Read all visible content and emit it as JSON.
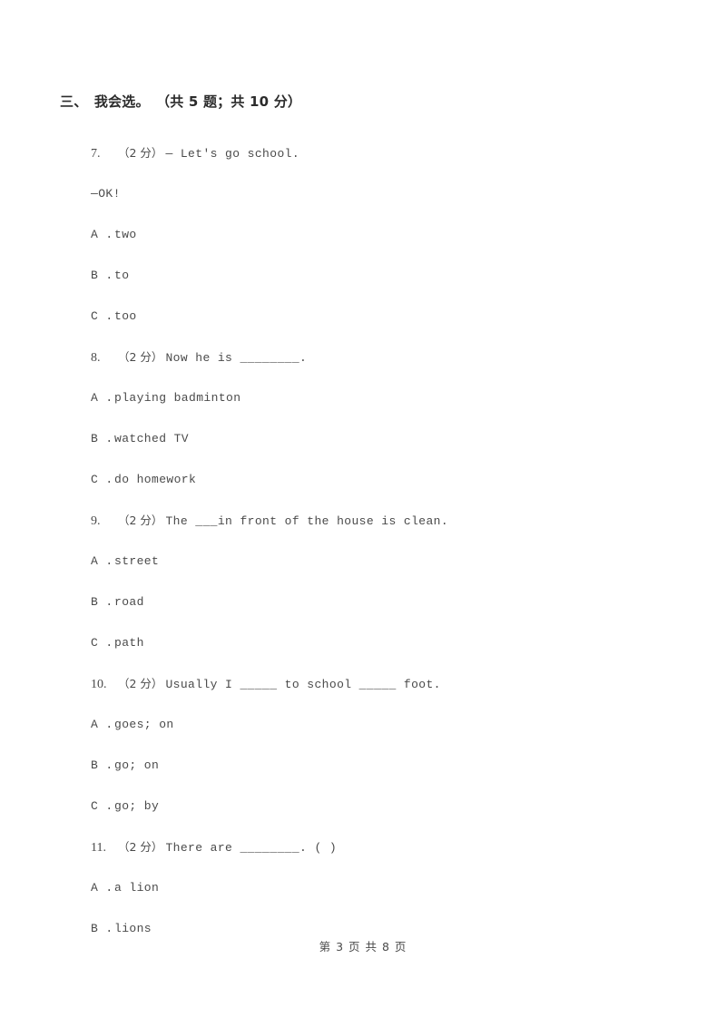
{
  "section": {
    "index_label": "三、",
    "title": "我会选。",
    "meta": "（共 5 题；共 10 分）"
  },
  "questions": [
    {
      "number": "7.",
      "score": "（2 分）",
      "stem": "— Let's go      school.",
      "continuation": "—OK!",
      "options": [
        {
          "letter": "A .",
          "text": "two"
        },
        {
          "letter": "B .",
          "text": "to"
        },
        {
          "letter": "C .",
          "text": "too"
        }
      ]
    },
    {
      "number": "8.",
      "score": "（2 分）",
      "stem": "Now he is ________.",
      "continuation": "",
      "options": [
        {
          "letter": "A .",
          "text": "playing badminton"
        },
        {
          "letter": "B .",
          "text": "watched TV"
        },
        {
          "letter": "C .",
          "text": "do homework"
        }
      ]
    },
    {
      "number": "9.",
      "score": "（2 分）",
      "stem": "The ___in front of the house is clean.",
      "continuation": "",
      "options": [
        {
          "letter": "A .",
          "text": "street"
        },
        {
          "letter": "B .",
          "text": "road"
        },
        {
          "letter": "C .",
          "text": "path"
        }
      ]
    },
    {
      "number": "10.",
      "score": "（2 分）",
      "stem": "Usually I _____ to school _____ foot.",
      "continuation": "",
      "options": [
        {
          "letter": "A .",
          "text": "goes; on"
        },
        {
          "letter": "B .",
          "text": "go; on"
        },
        {
          "letter": "C .",
          "text": "go; by"
        }
      ]
    },
    {
      "number": "11.",
      "score": "（2 分）",
      "stem": "There are ________. (    )",
      "continuation": "",
      "options": [
        {
          "letter": "A .",
          "text": "a lion"
        },
        {
          "letter": "B .",
          "text": "lions"
        }
      ]
    }
  ],
  "footer": {
    "text": "第 3 页 共 8 页"
  }
}
